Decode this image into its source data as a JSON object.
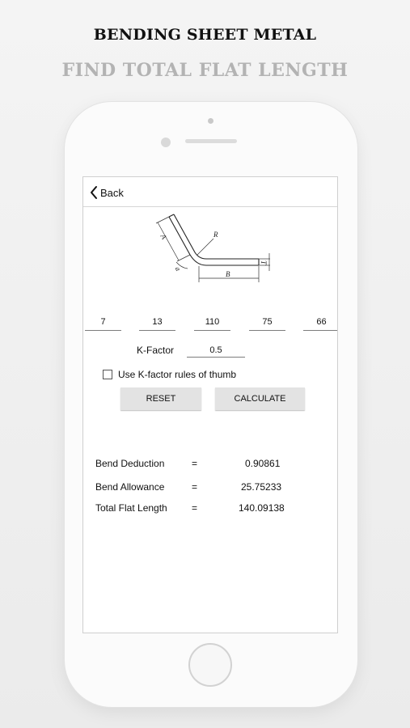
{
  "header": {
    "title": "BENDING SHEET METAL",
    "subtitle": "FIND TOTAL FLAT LENGTH"
  },
  "nav": {
    "back_label": "Back"
  },
  "diagram": {
    "labels": {
      "a": "A",
      "b": "B",
      "r": "R",
      "t": "T",
      "angle": "a"
    }
  },
  "inputs": {
    "values": [
      "7",
      "13",
      "110",
      "75",
      "66"
    ]
  },
  "kfactor": {
    "label": "K-Factor",
    "value": "0.5"
  },
  "rule_of_thumb": {
    "label": "Use K-factor rules of thumb",
    "checked": false
  },
  "buttons": {
    "reset": "RESET",
    "calculate": "CALCULATE"
  },
  "results": [
    {
      "label": "Bend Deduction",
      "eq": "=",
      "value": "0.90861"
    },
    {
      "label": "Bend Allowance",
      "eq": "=",
      "value": "25.75233"
    },
    {
      "label": "Total Flat Length",
      "eq": "=",
      "value": "140.09138"
    }
  ],
  "colors": {
    "title": "#111111",
    "subtitle": "#b3b3b3",
    "button_bg": "#e3e3e3"
  }
}
